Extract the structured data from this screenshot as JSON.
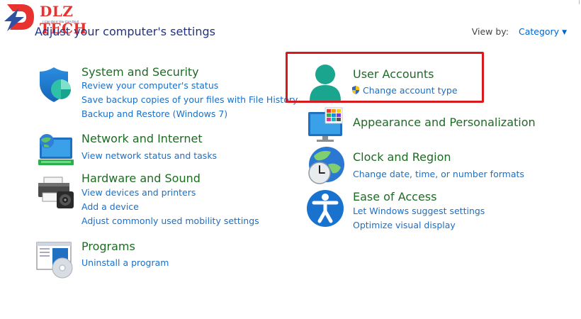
{
  "watermark": {
    "brand": "DLZ TECH",
    "tagline": "I Can Do It You Can Do It",
    "colors": {
      "primary": "#e7322f",
      "secondary": "#3050a0"
    }
  },
  "header": {
    "title": "Adjust your computer's settings",
    "view_by_label": "View by:",
    "view_by_value": "Category"
  },
  "colors": {
    "category_title": "#1e6b24",
    "link": "#1a6fc7",
    "highlight_border": "#d8191e"
  },
  "left_column": [
    {
      "icon": "shield-icon",
      "title": "System and Security",
      "links": [
        "Review your computer's status",
        "Save backup copies of your files with File History",
        "Backup and Restore (Windows 7)"
      ]
    },
    {
      "icon": "network-icon",
      "title": "Network and Internet",
      "links": [
        "View network status and tasks"
      ]
    },
    {
      "icon": "printer-icon",
      "title": "Hardware and Sound",
      "links": [
        "View devices and printers",
        "Add a device",
        "Adjust commonly used mobility settings"
      ]
    },
    {
      "icon": "programs-icon",
      "title": "Programs",
      "links": [
        "Uninstall a program"
      ]
    }
  ],
  "right_column": [
    {
      "icon": "user-icon",
      "title": "User Accounts",
      "links": [
        "Change account type"
      ],
      "link_icon": "uac-shield-icon",
      "highlighted": true
    },
    {
      "icon": "monitor-palette-icon",
      "title": "Appearance and Personalization",
      "links": []
    },
    {
      "icon": "clock-globe-icon",
      "title": "Clock and Region",
      "links": [
        "Change date, time, or number formats"
      ]
    },
    {
      "icon": "accessibility-icon",
      "title": "Ease of Access",
      "links": [
        "Let Windows suggest settings",
        "Optimize visual display"
      ]
    }
  ]
}
